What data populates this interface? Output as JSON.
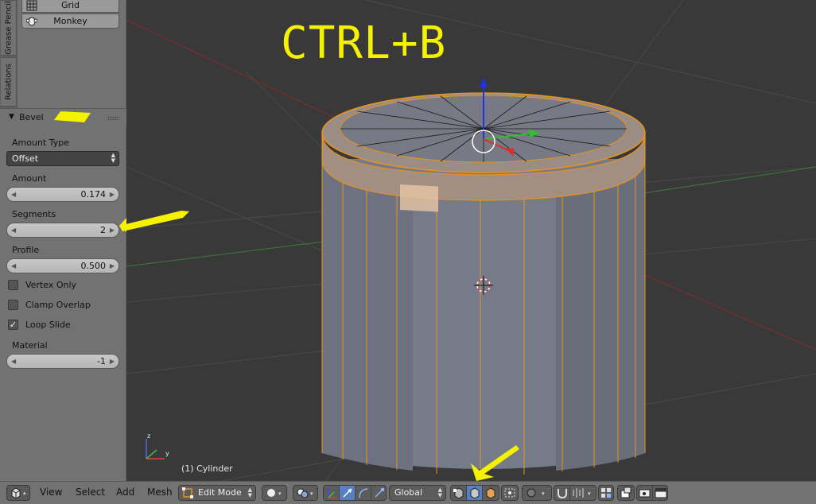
{
  "overlay": {
    "shortcut": "CTRL+B"
  },
  "viewport": {
    "object_label": "(1) Cylinder"
  },
  "toolshelf": {
    "tabs": [
      "Grease Pencil",
      "Relations"
    ],
    "add_buttons": [
      {
        "label": "Grid",
        "icon": "grid-icon"
      },
      {
        "label": "Monkey",
        "icon": "monkey-icon"
      }
    ]
  },
  "bevel_panel": {
    "title": "Bevel",
    "amount_type": {
      "label": "Amount Type",
      "value": "Offset"
    },
    "amount": {
      "label": "Amount",
      "value": "0.174"
    },
    "segments": {
      "label": "Segments",
      "value": "2"
    },
    "profile": {
      "label": "Profile",
      "value": "0.500"
    },
    "checkboxes": [
      {
        "label": "Vertex Only",
        "checked": false
      },
      {
        "label": "Clamp Overlap",
        "checked": false
      },
      {
        "label": "Loop Slide",
        "checked": true
      }
    ],
    "material": {
      "label": "Material",
      "value": "-1"
    }
  },
  "header": {
    "menus": [
      "View",
      "Select",
      "Add",
      "Mesh"
    ],
    "mode": "Edit Mode",
    "orientation": "Global"
  },
  "colors": {
    "annotation": "#f4f200",
    "selection": "#f5a623",
    "viewport_bg": "#393939",
    "panel_bg": "#727272",
    "active_blue": "#5680c2"
  }
}
